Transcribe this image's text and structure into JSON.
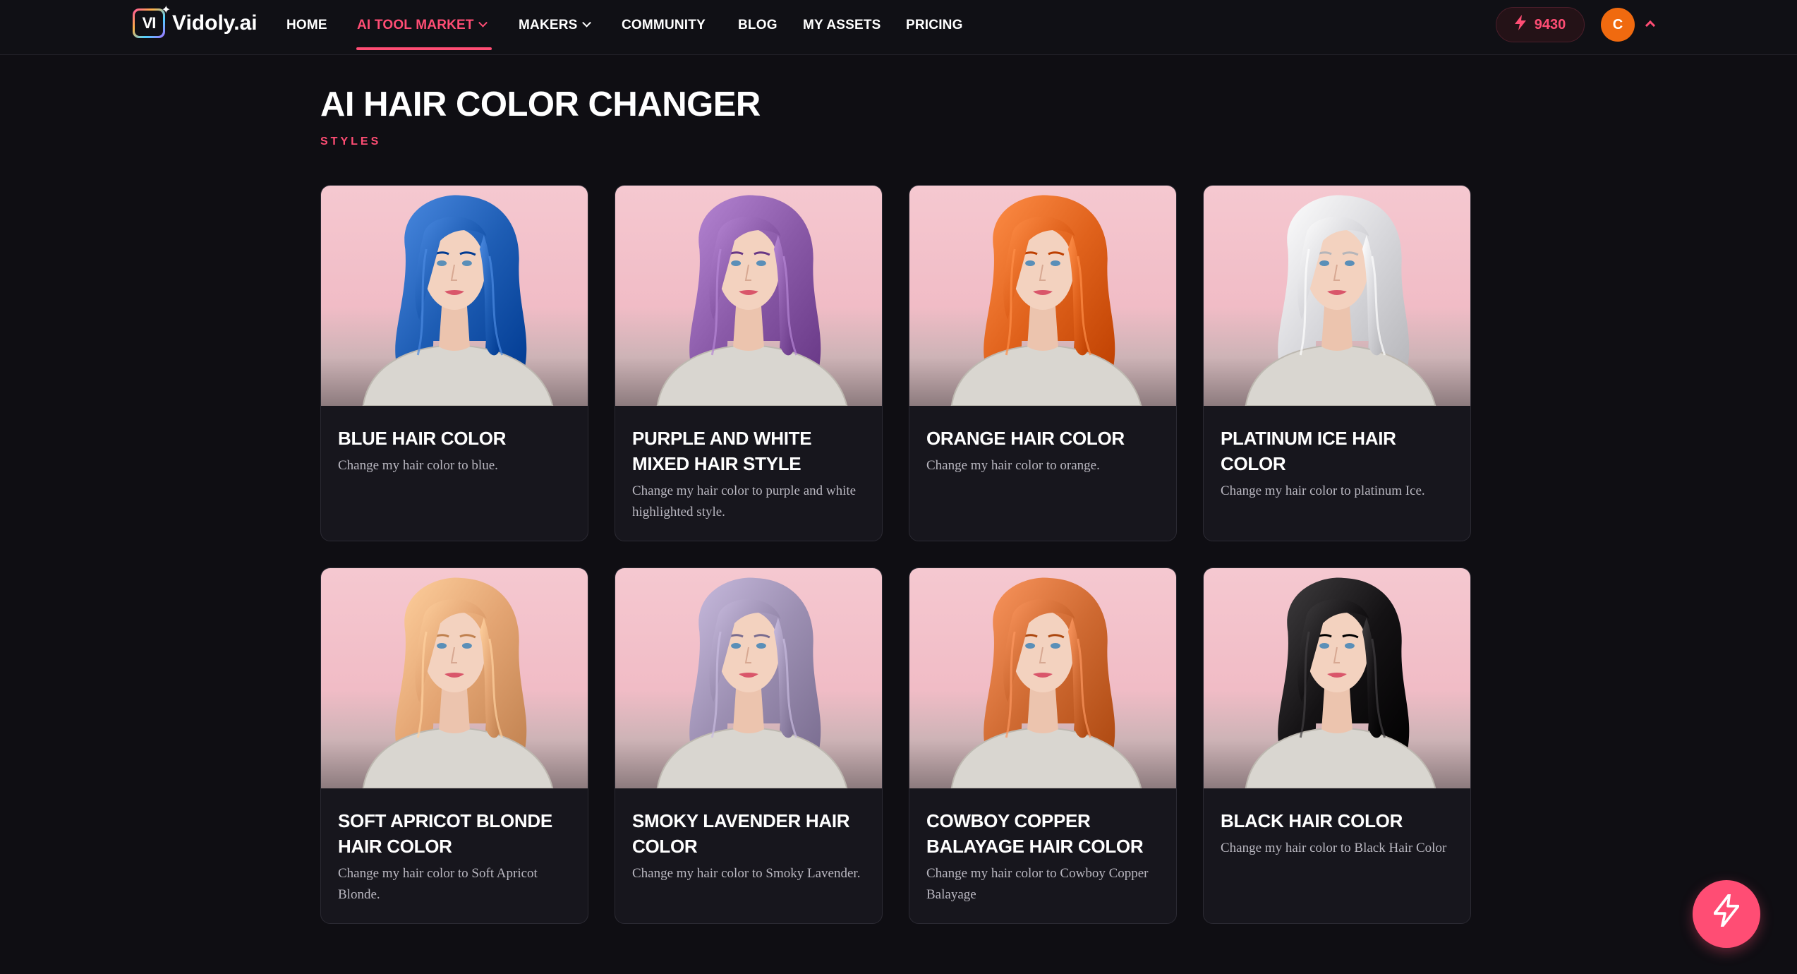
{
  "brand": {
    "name": "Vidoly.ai",
    "mark": "VI"
  },
  "nav": {
    "items": [
      {
        "label": "HOME",
        "active": false,
        "has_dropdown": false
      },
      {
        "label": "AI TOOL MARKET",
        "active": true,
        "has_dropdown": true
      },
      {
        "label": "MAKERS",
        "active": false,
        "has_dropdown": true
      },
      {
        "label": "COMMUNITY",
        "active": false,
        "has_dropdown": false
      },
      {
        "label": "BLOG",
        "active": false,
        "has_dropdown": false
      },
      {
        "label": "MY ASSETS",
        "active": false,
        "has_dropdown": false
      },
      {
        "label": "PRICING",
        "active": false,
        "has_dropdown": false
      }
    ],
    "credits": "9430",
    "avatar_initial": "C"
  },
  "page": {
    "title": "AI HAIR COLOR CHANGER",
    "section_label": "STYLES"
  },
  "cards": [
    {
      "title": "BLUE HAIR COLOR",
      "description": "Change my hair color to blue.",
      "hair_color": "#1e5db4"
    },
    {
      "title": "PURPLE AND WHITE MIXED HAIR STYLE",
      "description": "Change my hair color to purple and white highlighted style.",
      "hair_color": "#8a5aa8"
    },
    {
      "title": "ORANGE HAIR COLOR",
      "description": "Change my hair color to orange.",
      "hair_color": "#e0621c"
    },
    {
      "title": "PLATINUM ICE HAIR COLOR",
      "description": "Change my hair color to platinum Ice.",
      "hair_color": "#d8d8dc"
    },
    {
      "title": "SOFT APRICOT BLONDE HAIR COLOR",
      "description": "Change my hair color to Soft Apricot Blonde.",
      "hair_color": "#e3a472"
    },
    {
      "title": "SMOKY LAVENDER HAIR COLOR",
      "description": "Change my hair color to Smoky Lavender.",
      "hair_color": "#9c8fb2"
    },
    {
      "title": "COWBOY COPPER BALAYAGE HAIR COLOR",
      "description": "Change my hair color to Cowboy Copper Balayage",
      "hair_color": "#cf6a32"
    },
    {
      "title": "BLACK HAIR COLOR",
      "description": "Change my hair color to Black Hair Color",
      "hair_color": "#141214"
    }
  ],
  "colors": {
    "accent": "#ff4d74",
    "background": "#0f0e13",
    "card": "#17161d",
    "avatar": "#f06a0f"
  },
  "icons": {
    "credits": "lightning-bolt-icon",
    "fab": "lightning-bolt-icon",
    "user_menu_toggle": "chevron-up-icon"
  }
}
